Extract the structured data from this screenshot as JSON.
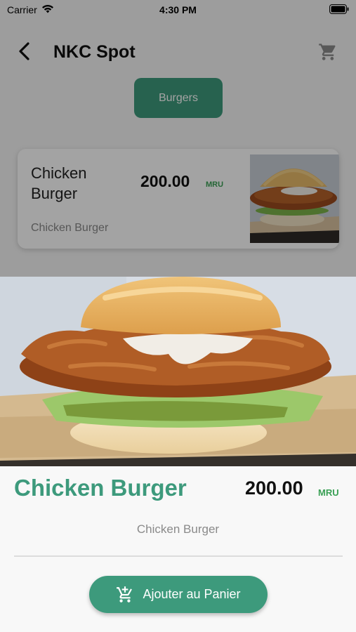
{
  "status_bar": {
    "carrier": "Carrier",
    "time": "4:30 PM",
    "wifi_icon": "wifi-icon",
    "battery_icon": "battery-icon"
  },
  "nav": {
    "back_icon": "chevron-left-icon",
    "title": "NKC Spot",
    "cart_icon": "shopping-cart-icon"
  },
  "categories": [
    {
      "label": "Burgers",
      "selected": true
    }
  ],
  "product_card": {
    "name": "Chicken Burger",
    "price": "200.00",
    "currency": "MRU",
    "description": "Chicken Burger"
  },
  "detail": {
    "title": "Chicken Burger",
    "price": "200.00",
    "currency": "MRU",
    "description": "Chicken Burger",
    "add_button_label": "Ajouter au Panier",
    "add_button_icon": "add-to-cart-icon"
  },
  "colors": {
    "accent": "#3d9a7c",
    "currency": "#3aa055"
  }
}
